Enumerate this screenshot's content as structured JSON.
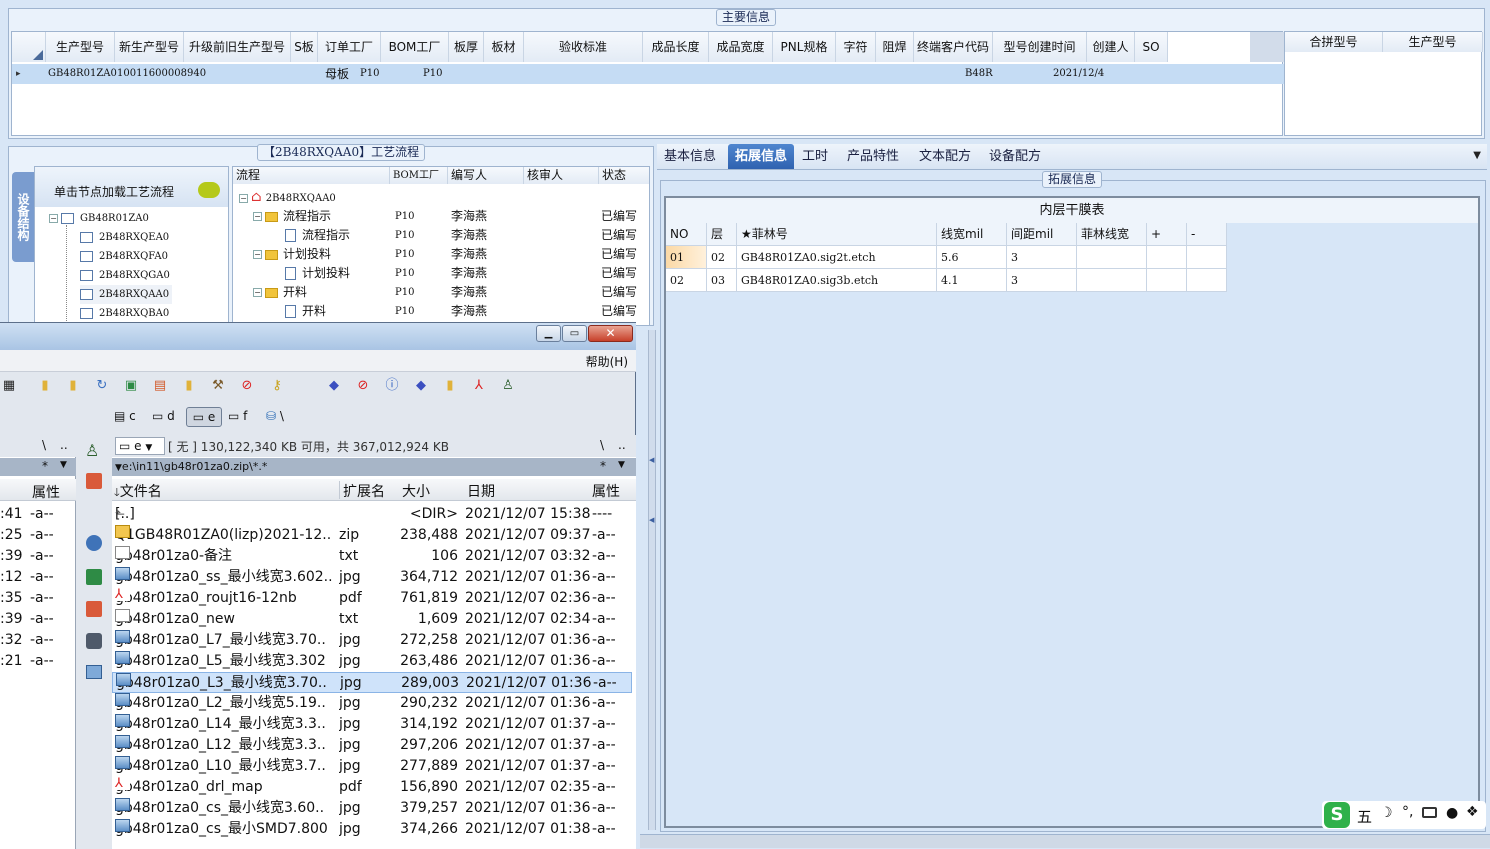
{
  "main_info": {
    "legend": "主要信息",
    "columns": [
      "生产型号",
      "新生产型号",
      "升级前旧生产型号",
      "S板",
      "订单工厂",
      "BOM工厂",
      "板厚",
      "板材",
      "验收标准",
      "成品长度",
      "成品宽度",
      "PNL规格",
      "字符",
      "阻焊",
      "终端客户代码",
      "型号创建时间",
      "创建人",
      "SO"
    ],
    "row": {
      "marker": "▸",
      "model": "GB48R01ZA0",
      "new_model": "10011600008940",
      "s_board": "母板",
      "order_factory": "P10",
      "bom_factory": "P10",
      "customer_code": "B48R",
      "created": "2021/12/4"
    },
    "side_columns": [
      "合拼型号",
      "生产型号"
    ]
  },
  "flow": {
    "legend": "【2B48RXQAA0】工艺流程",
    "vtab": "设备结构",
    "hint": "单击节点加载工艺流程",
    "tree": [
      "GB48R01ZA0",
      "2B48RXQEA0",
      "2B48RXQFA0",
      "2B48RXQGA0",
      "2B48RXQAA0",
      "2B48RXQBA0"
    ],
    "grid_headers": [
      "流程",
      "BOM工厂",
      "编写人",
      "核审人",
      "状态"
    ],
    "grid_rows": [
      {
        "name": "2B48RXQAA0",
        "factory": "",
        "writer": "",
        "reviewer": "",
        "status": ""
      },
      {
        "name": "流程指示",
        "factory": "P10",
        "writer": "李海燕",
        "reviewer": "",
        "status": "已编写"
      },
      {
        "name": "流程指示",
        "factory": "P10",
        "writer": "李海燕",
        "reviewer": "",
        "status": "已编写"
      },
      {
        "name": "计划投料",
        "factory": "P10",
        "writer": "李海燕",
        "reviewer": "",
        "status": "已编写"
      },
      {
        "name": "计划投料",
        "factory": "P10",
        "writer": "李海燕",
        "reviewer": "",
        "status": "已编写"
      },
      {
        "name": "开料",
        "factory": "P10",
        "writer": "李海燕",
        "reviewer": "",
        "status": "已编写"
      },
      {
        "name": "开料",
        "factory": "P10",
        "writer": "李海燕",
        "reviewer": "",
        "status": "已编写"
      }
    ]
  },
  "detail": {
    "tabs": [
      "基本信息",
      "拓展信息",
      "工时",
      "产品特性",
      "文本配方",
      "设备配方"
    ],
    "active_tab": "拓展信息",
    "legend": "拓展信息",
    "table_title": "内层干膜表",
    "headers": [
      "NO",
      "层",
      "★菲林号",
      "线宽mil",
      "间距mil",
      "菲林线宽",
      "+",
      "-"
    ],
    "rows": [
      {
        "no": "01",
        "layer": "02",
        "film": "GB48R01ZA0.sig2t.etch",
        "width": "5.6",
        "gap": "3",
        "fw": ""
      },
      {
        "no": "02",
        "layer": "03",
        "film": "GB48R01ZA0.sig3b.etch",
        "width": "4.1",
        "gap": "3",
        "fw": ""
      }
    ]
  },
  "fm": {
    "menu_help": "帮助(H)",
    "drives": [
      "c",
      "d",
      "e",
      "f",
      "\\"
    ],
    "drive_sel": "e",
    "free_info": "[ 无 ] 130,122,340 KB 可用，共 367,012,924 KB",
    "path": "e:\\in11\\gb48r01za0.zip\\*.*",
    "nav_back": "\\",
    "nav_up": "..",
    "filter": "*",
    "col_name": "文件名",
    "col_ext": "扩展名",
    "col_size": "大小",
    "col_date": "日期",
    "col_attr": "属性",
    "files": [
      {
        "type": "up",
        "name": "[..]",
        "ext": "",
        "size": "<DIR>",
        "date": "2021/12/07 15:38",
        "attr": "----"
      },
      {
        "type": "zip",
        "name": "Q1GB48R01ZA0(lizp)2021-12..",
        "ext": "zip",
        "size": "238,488",
        "date": "2021/12/07 09:37",
        "attr": "-a--"
      },
      {
        "type": "txt",
        "name": "gb48r01za0-备注",
        "ext": "txt",
        "size": "106",
        "date": "2021/12/07 03:32",
        "attr": "-a--"
      },
      {
        "type": "img",
        "name": "gb48r01za0_ss_最小线宽3.602..",
        "ext": "jpg",
        "size": "364,712",
        "date": "2021/12/07 01:36",
        "attr": "-a--"
      },
      {
        "type": "pdf",
        "name": "gb48r01za0_roujt16-12nb",
        "ext": "pdf",
        "size": "761,819",
        "date": "2021/12/07 02:36",
        "attr": "-a--"
      },
      {
        "type": "txt",
        "name": "gb48r01za0_new",
        "ext": "txt",
        "size": "1,609",
        "date": "2021/12/07 02:34",
        "attr": "-a--"
      },
      {
        "type": "img",
        "name": "gb48r01za0_L7_最小线宽3.70..",
        "ext": "jpg",
        "size": "272,258",
        "date": "2021/12/07 01:36",
        "attr": "-a--"
      },
      {
        "type": "img",
        "name": "gb48r01za0_L5_最小线宽3.302",
        "ext": "jpg",
        "size": "263,486",
        "date": "2021/12/07 01:36",
        "attr": "-a--"
      },
      {
        "type": "img",
        "name": "gb48r01za0_L3_最小线宽3.70..",
        "ext": "jpg",
        "size": "289,003",
        "date": "2021/12/07 01:36",
        "attr": "-a--"
      },
      {
        "type": "img",
        "name": "gb48r01za0_L2_最小线宽5.19..",
        "ext": "jpg",
        "size": "290,232",
        "date": "2021/12/07 01:36",
        "attr": "-a--"
      },
      {
        "type": "img",
        "name": "gb48r01za0_L14_最小线宽3.3..",
        "ext": "jpg",
        "size": "314,192",
        "date": "2021/12/07 01:37",
        "attr": "-a--"
      },
      {
        "type": "img",
        "name": "gb48r01za0_L12_最小线宽3.3..",
        "ext": "jpg",
        "size": "297,206",
        "date": "2021/12/07 01:37",
        "attr": "-a--"
      },
      {
        "type": "img",
        "name": "gb48r01za0_L10_最小线宽3.7..",
        "ext": "jpg",
        "size": "277,889",
        "date": "2021/12/07 01:37",
        "attr": "-a--"
      },
      {
        "type": "pdf",
        "name": "gb48r01za0_drl_map",
        "ext": "pdf",
        "size": "156,890",
        "date": "2021/12/07 02:35",
        "attr": "-a--"
      },
      {
        "type": "img",
        "name": "gb48r01za0_cs_最小线宽3.60..",
        "ext": "jpg",
        "size": "379,257",
        "date": "2021/12/07 01:36",
        "attr": "-a--"
      },
      {
        "type": "img",
        "name": "gb48r01za0_cs_最小SMD7.800",
        "ext": "jpg",
        "size": "374,266",
        "date": "2021/12/07 01:38",
        "attr": "-a--"
      }
    ],
    "selected_index": 8,
    "left_times": [
      ":41",
      ":25",
      ":39",
      ":12",
      ":35",
      ":39",
      ":32",
      ":21"
    ],
    "left_attr": "-a--"
  },
  "ime": {
    "mode": "五"
  }
}
